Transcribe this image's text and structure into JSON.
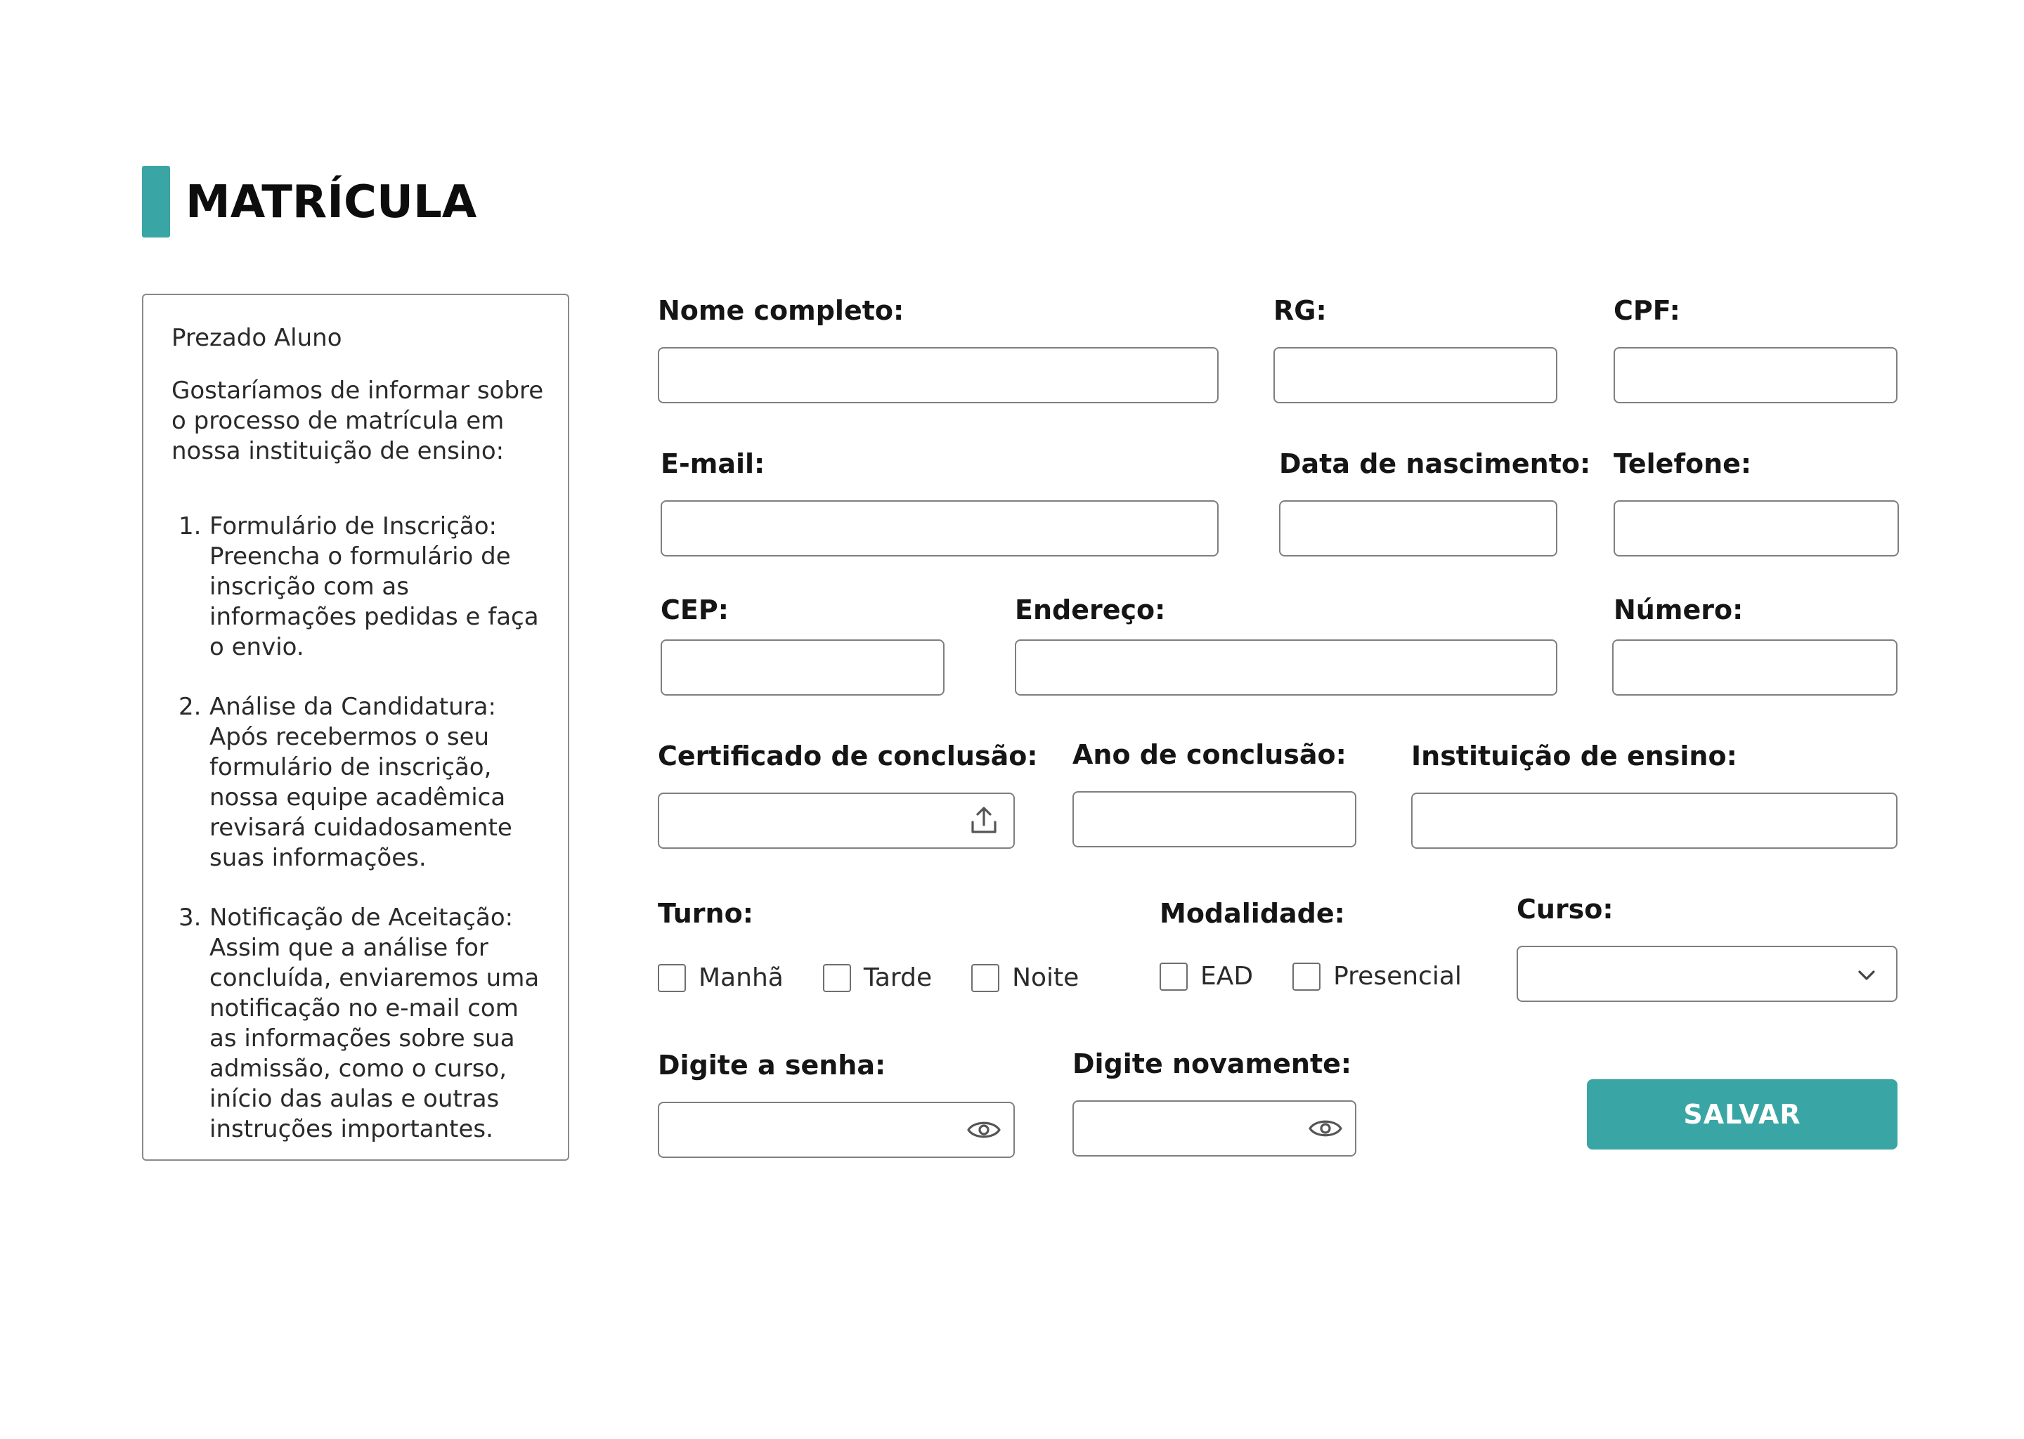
{
  "header": {
    "title": "MATRÍCULA",
    "accent_color": "#3aa5a5"
  },
  "info": {
    "greeting": "Prezado Aluno",
    "intro": "Gostaríamos de informar sobre o processo de matrícula em nossa instituição de ensino:",
    "steps": [
      {
        "num": "1.",
        "text": "Formulário de Inscrição: Preencha o formulário de inscrição com as informações pedidas e faça o envio."
      },
      {
        "num": "2.",
        "text": "Análise da Candidatura: Após recebermos o seu formulário de inscrição, nossa equipe acadêmica revisará cuidadosamente suas informações."
      },
      {
        "num": "3.",
        "text": "Notificação de Aceitação: Assim que a análise for concluída, enviaremos uma notificação no e-mail com  as informações sobre sua admissão, como o curso, início das aulas e outras instruções importantes."
      }
    ]
  },
  "form": {
    "nome": {
      "label": "Nome completo:",
      "value": ""
    },
    "rg": {
      "label": "RG:",
      "value": ""
    },
    "cpf": {
      "label": "CPF:",
      "value": ""
    },
    "email": {
      "label": "E-mail:",
      "value": ""
    },
    "nascimento": {
      "label": "Data de nascimento:",
      "value": ""
    },
    "telefone": {
      "label": "Telefone:",
      "value": ""
    },
    "cep": {
      "label": "CEP:",
      "value": ""
    },
    "endereco": {
      "label": "Endereço:",
      "value": ""
    },
    "numero": {
      "label": "Número:",
      "value": ""
    },
    "certificado": {
      "label": "Certificado de conclusão:",
      "value": "",
      "icon": "upload-icon"
    },
    "ano": {
      "label": "Ano de conclusão:",
      "value": ""
    },
    "instituicao": {
      "label": "Instituição de ensino:",
      "value": ""
    },
    "turno": {
      "label": "Turno:",
      "options": [
        "Manhã",
        "Tarde",
        "Noite"
      ],
      "checked": [
        false,
        false,
        false
      ]
    },
    "modalidade": {
      "label": "Modalidade:",
      "options": [
        "EAD",
        "Presencial"
      ],
      "checked": [
        false,
        false
      ]
    },
    "curso": {
      "label": "Curso:",
      "selected": "",
      "icon": "chevron-down-icon"
    },
    "senha": {
      "label": "Digite a senha:",
      "value": "",
      "icon": "eye-icon"
    },
    "senha2": {
      "label": "Digite novamente:",
      "value": "",
      "icon": "eye-icon"
    },
    "save_label": "SALVAR",
    "button_color": "#3aa5a5"
  }
}
